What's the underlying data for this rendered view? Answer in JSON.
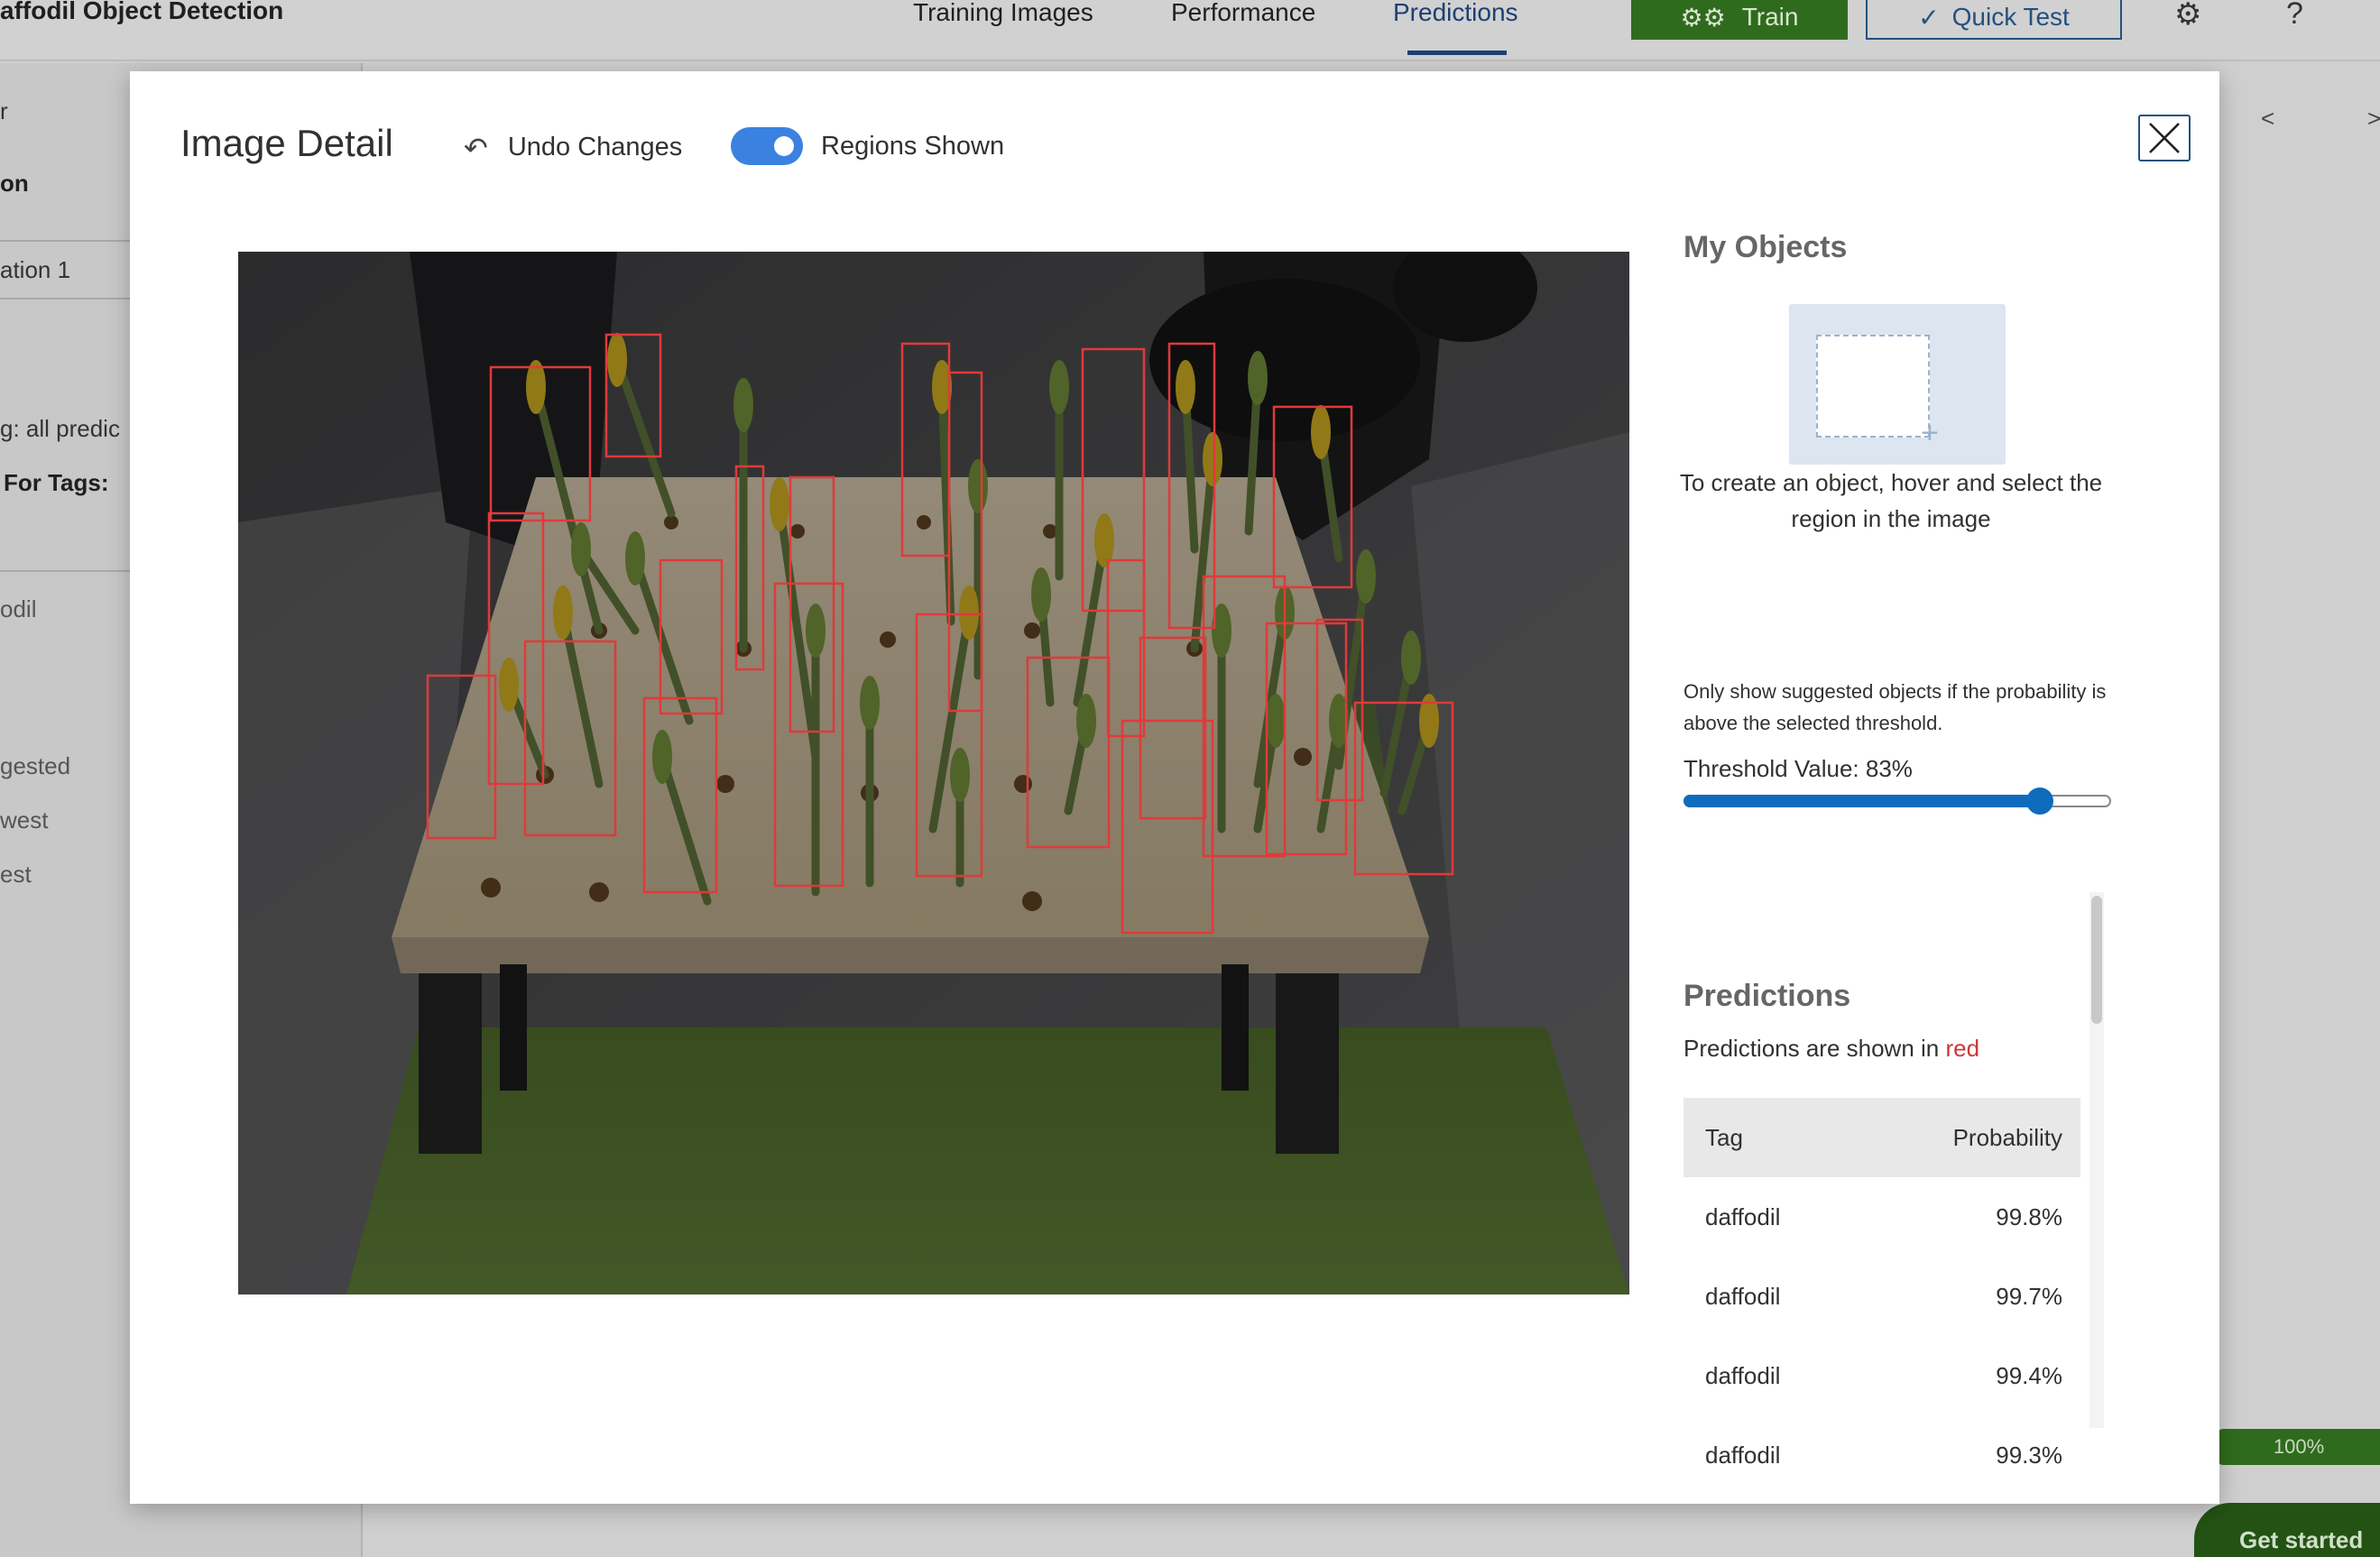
{
  "app": {
    "title": "affodil Object Detection",
    "nav_tabs": [
      {
        "label": "Training Images"
      },
      {
        "label": "Performance"
      },
      {
        "label": "Predictions"
      }
    ],
    "train_label": "Train",
    "quick_test_label": "Quick Test",
    "progress_text": "100%",
    "get_started_label": "Get started"
  },
  "left_panel": {
    "items": [
      "r",
      "on",
      "ation 1",
      "g: all predic",
      "For Tags:",
      "odil",
      "gested",
      "west",
      "est"
    ]
  },
  "modal": {
    "title": "Image Detail",
    "undo_label": "Undo Changes",
    "regions_toggle_label": "Regions Shown",
    "regions_shown": true,
    "my_objects": {
      "title": "My Objects",
      "help": "To create an object, hover and select the region in the image"
    },
    "threshold": {
      "help": "Only show suggested objects if the probability is above the selected threshold.",
      "label": "Threshold Value: 83%",
      "value": 0.83
    },
    "predictions": {
      "title": "Predictions",
      "desc_prefix": "Predictions are shown in ",
      "desc_color_word": "red",
      "columns": [
        "Tag",
        "Probability"
      ],
      "rows": [
        {
          "tag": "daffodil",
          "probability": "99.8%"
        },
        {
          "tag": "daffodil",
          "probability": "99.7%"
        },
        {
          "tag": "daffodil",
          "probability": "99.4%"
        },
        {
          "tag": "daffodil",
          "probability": "99.3%"
        }
      ]
    }
  },
  "colors": {
    "accent": "#0f6cbd",
    "prediction_box": "#e03a3a",
    "train_green": "#2f6b1d",
    "nav_active": "#1d3f73"
  }
}
